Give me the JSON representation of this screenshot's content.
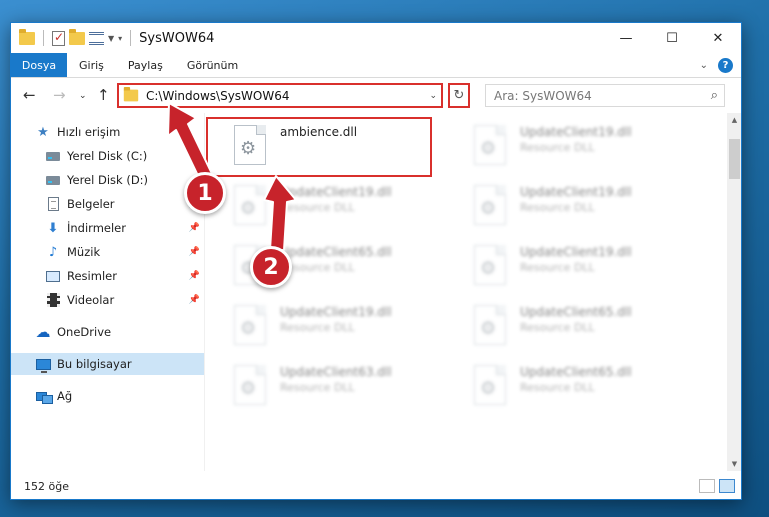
{
  "window": {
    "title": "SysWOW64"
  },
  "ribbon": {
    "tabs": [
      "Dosya",
      "Giriş",
      "Paylaş",
      "Görünüm"
    ]
  },
  "address": {
    "path": "C:\\Windows\\SysWOW64"
  },
  "search": {
    "placeholder": "Ara: SysWOW64"
  },
  "sidebar": {
    "items": [
      {
        "label": "Hızlı erişim",
        "icon": "star-icon"
      },
      {
        "label": "Yerel Disk (C:)",
        "icon": "drive-icon"
      },
      {
        "label": "Yerel Disk (D:)",
        "icon": "drive-icon"
      },
      {
        "label": "Belgeler",
        "icon": "document-icon"
      },
      {
        "label": "İndirmeler",
        "icon": "download-icon"
      },
      {
        "label": "Müzik",
        "icon": "music-icon"
      },
      {
        "label": "Resimler",
        "icon": "pictures-icon"
      },
      {
        "label": "Videolar",
        "icon": "video-icon"
      },
      {
        "label": "OneDrive",
        "icon": "cloud-icon"
      },
      {
        "label": "Bu bilgisayar",
        "icon": "computer-icon"
      },
      {
        "label": "Ağ",
        "icon": "network-icon"
      }
    ]
  },
  "files": [
    {
      "name": "ambience.dll",
      "type": ""
    },
    {
      "name": "UpdateClient19.dll",
      "type": "Resource DLL"
    },
    {
      "name": "UpdateClient19.dll",
      "type": "Resource DLL"
    },
    {
      "name": "UpdateClient19.dll",
      "type": "Resource DLL"
    },
    {
      "name": "UpdateClient65.dll",
      "type": "Resource DLL"
    },
    {
      "name": "UpdateClient19.dll",
      "type": "Resource DLL"
    },
    {
      "name": "UpdateClient19.dll",
      "type": "Resource DLL"
    },
    {
      "name": "UpdateClient65.dll",
      "type": "Resource DLL"
    },
    {
      "name": "UpdateClient63.dll",
      "type": "Resource DLL"
    },
    {
      "name": "UpdateClient65.dll",
      "type": "Resource DLL"
    }
  ],
  "status": {
    "count": "152 öğe"
  },
  "annotations": {
    "step1": "1",
    "step2": "2",
    "color": "#c7232b"
  }
}
